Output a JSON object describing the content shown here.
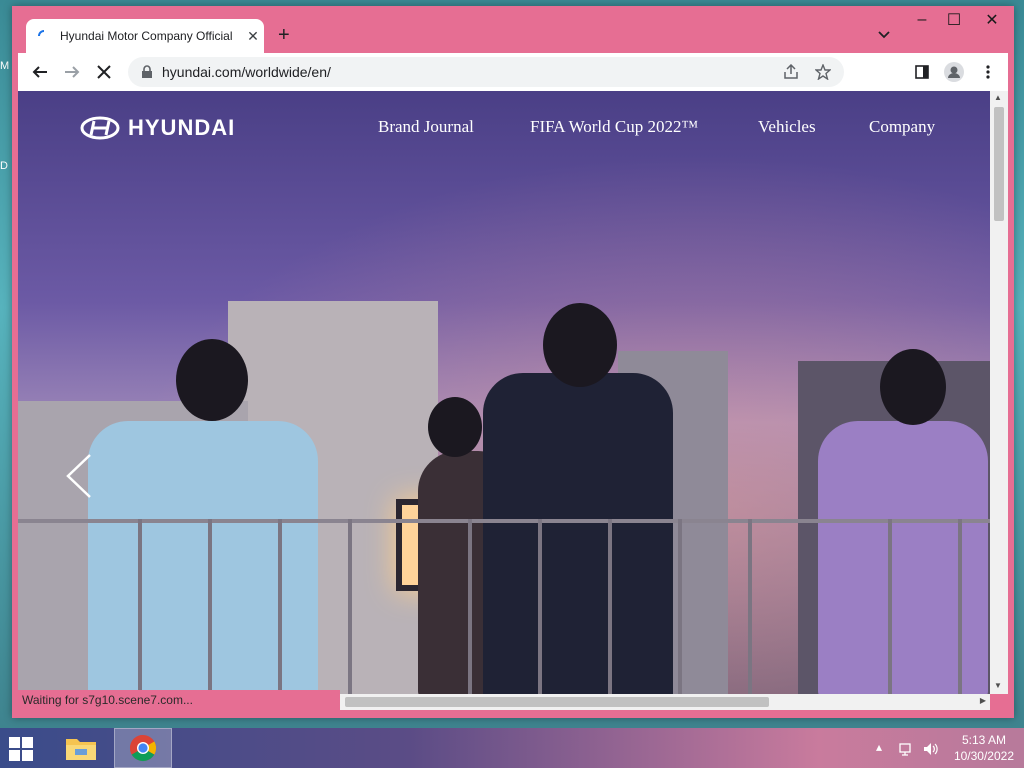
{
  "desktop": {
    "left_edge_labels": [
      "M",
      "D"
    ]
  },
  "browser": {
    "tab": {
      "title": "Hyundai Motor Company Official"
    },
    "address_bar": {
      "url": "hyundai.com/worldwide/en/"
    },
    "status_text": "Waiting for s7g10.scene7.com..."
  },
  "page": {
    "logo_text": "HYUNDAI",
    "nav": [
      {
        "label": "Brand Journal"
      },
      {
        "label": "FIFA World Cup 2022™"
      },
      {
        "label": "Vehicles"
      },
      {
        "label": "Company"
      }
    ]
  },
  "taskbar": {
    "clock": {
      "time": "5:13 AM",
      "date": "10/30/2022"
    }
  },
  "colors": {
    "window_frame": "#e66e93",
    "accent": "#1a73e8"
  },
  "icons": [
    "chrome-icon",
    "file-explorer-icon",
    "windows-start-icon",
    "network-icon",
    "volume-icon"
  ]
}
